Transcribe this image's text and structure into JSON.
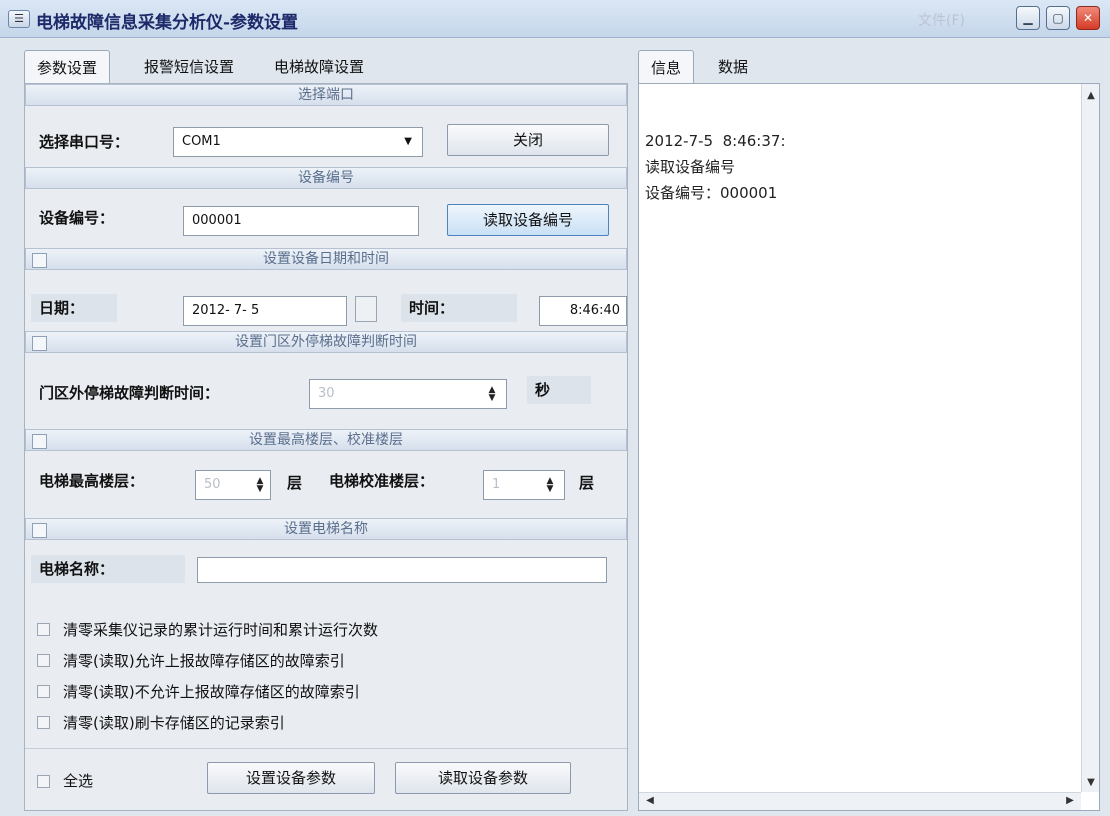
{
  "window": {
    "title": "电梯故障信息采集分析仪-参数设置",
    "file_menu": "文件(F)"
  },
  "left_tabs": [
    "参数设置",
    "报警短信设置",
    "电梯故障设置"
  ],
  "right_tabs": [
    "信息",
    "数据"
  ],
  "port": {
    "header": "选择端口",
    "label": "选择串口号：",
    "value": "COM1",
    "button": "关闭"
  },
  "device": {
    "header": "设备编号",
    "label": "设备编号：",
    "value": "000001",
    "button": "读取设备编号"
  },
  "datetime": {
    "header": "设置设备日期和时间",
    "date_label": "日期：",
    "date_value": "2012- 7- 5",
    "time_label": "时间：",
    "time_value": "8:46:40"
  },
  "door_stop": {
    "header": "设置门区外停梯故障判断时间",
    "label": "门区外停梯故障判断时间：",
    "value": "30",
    "unit": "秒"
  },
  "floors": {
    "header": "设置最高楼层、校准楼层",
    "max_label": "电梯最高楼层：",
    "max_value": "50",
    "max_unit": "层",
    "cal_label": "电梯校准楼层：",
    "cal_value": "1",
    "cal_unit": "层"
  },
  "elevator_name": {
    "header": "设置电梯名称",
    "label": "电梯名称：",
    "value": ""
  },
  "options": [
    "清零采集仪记录的累计运行时间和累计运行次数",
    "清零(读取)允许上报故障存储区的故障索引",
    "清零(读取)不允许上报故障存储区的故障索引",
    "清零(读取)刷卡存储区的记录索引"
  ],
  "footer": {
    "select_all": "全选",
    "set_button": "设置设备参数",
    "read_button": "读取设备参数"
  },
  "log": {
    "lines": [
      "2012-7-5  8:46:37:",
      "读取设备编号",
      "设备编号：000001"
    ]
  }
}
